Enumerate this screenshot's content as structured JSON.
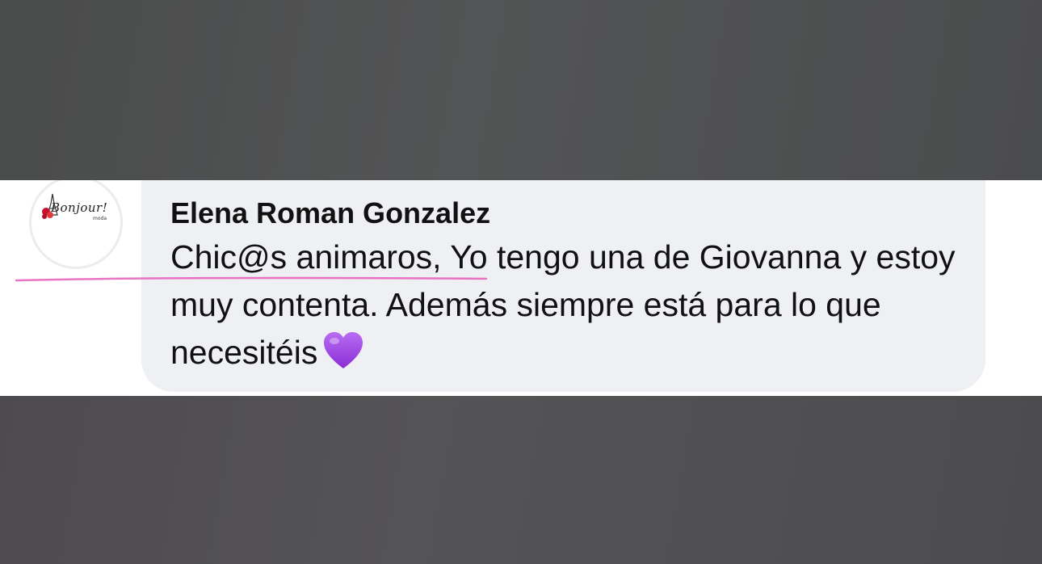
{
  "comment": {
    "avatar": {
      "logo_text": "Bonjour!",
      "logo_sub": "moda"
    },
    "author": "Elena Roman Gonzalez",
    "text": "Chic@s animaros, Yo tengo una de Giovanna y estoy muy contenta. Además siempre está para lo que necesitéis",
    "emoji": "purple-heart"
  },
  "colors": {
    "bubble": "#eff0f4",
    "highlight": "#e85ab8",
    "heart": "#9b3de3"
  }
}
